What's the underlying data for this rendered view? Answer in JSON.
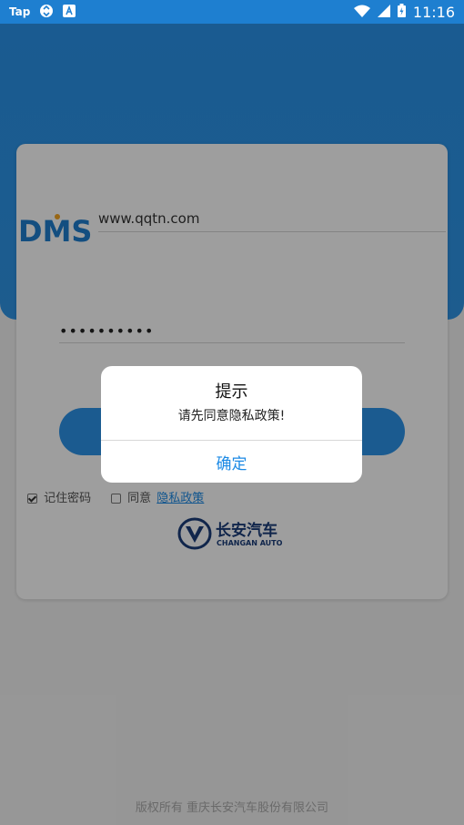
{
  "status_bar": {
    "left_text": "Tap",
    "time": "11:16",
    "icons": [
      "tap-app-icon",
      "sync-icon",
      "text-app-icon",
      "wifi-icon",
      "signal-icon",
      "battery-icon"
    ]
  },
  "login": {
    "server_value": "www.qqtn.com",
    "password_value": "••••••••••",
    "login_button_label": "",
    "remember_label": "记住密码",
    "remember_checked": true,
    "agree_label": "同意",
    "agree_checked": false,
    "privacy_link_label": "隐私政策",
    "logo_text": "DMS"
  },
  "brand": {
    "name_cn": "长安汽车",
    "name_en": "CHANGAN AUTO"
  },
  "footer": {
    "copyright": "版权所有 重庆长安汽车股份有限公司"
  },
  "dialog": {
    "title": "提示",
    "message": "请先同意隐私政策!",
    "confirm_label": "确定"
  },
  "colors": {
    "primary": "#2c93e8",
    "status_bar": "#1e7fd0",
    "dialog_button": "#1c8ae5"
  }
}
